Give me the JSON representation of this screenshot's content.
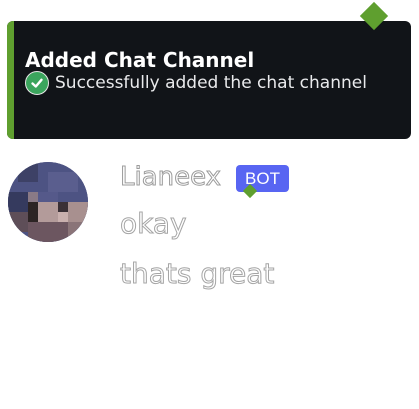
{
  "toast": {
    "title": "Added Chat Channel",
    "message": "Successfully added the chat channel",
    "status_icon": "check-circle-icon",
    "accent_color": "#5f9f2f"
  },
  "message": {
    "username": "Lianeex",
    "bot_badge": "BOT",
    "bot_badge_color": "#5865f2",
    "lines": [
      "okay",
      "thats great"
    ]
  }
}
